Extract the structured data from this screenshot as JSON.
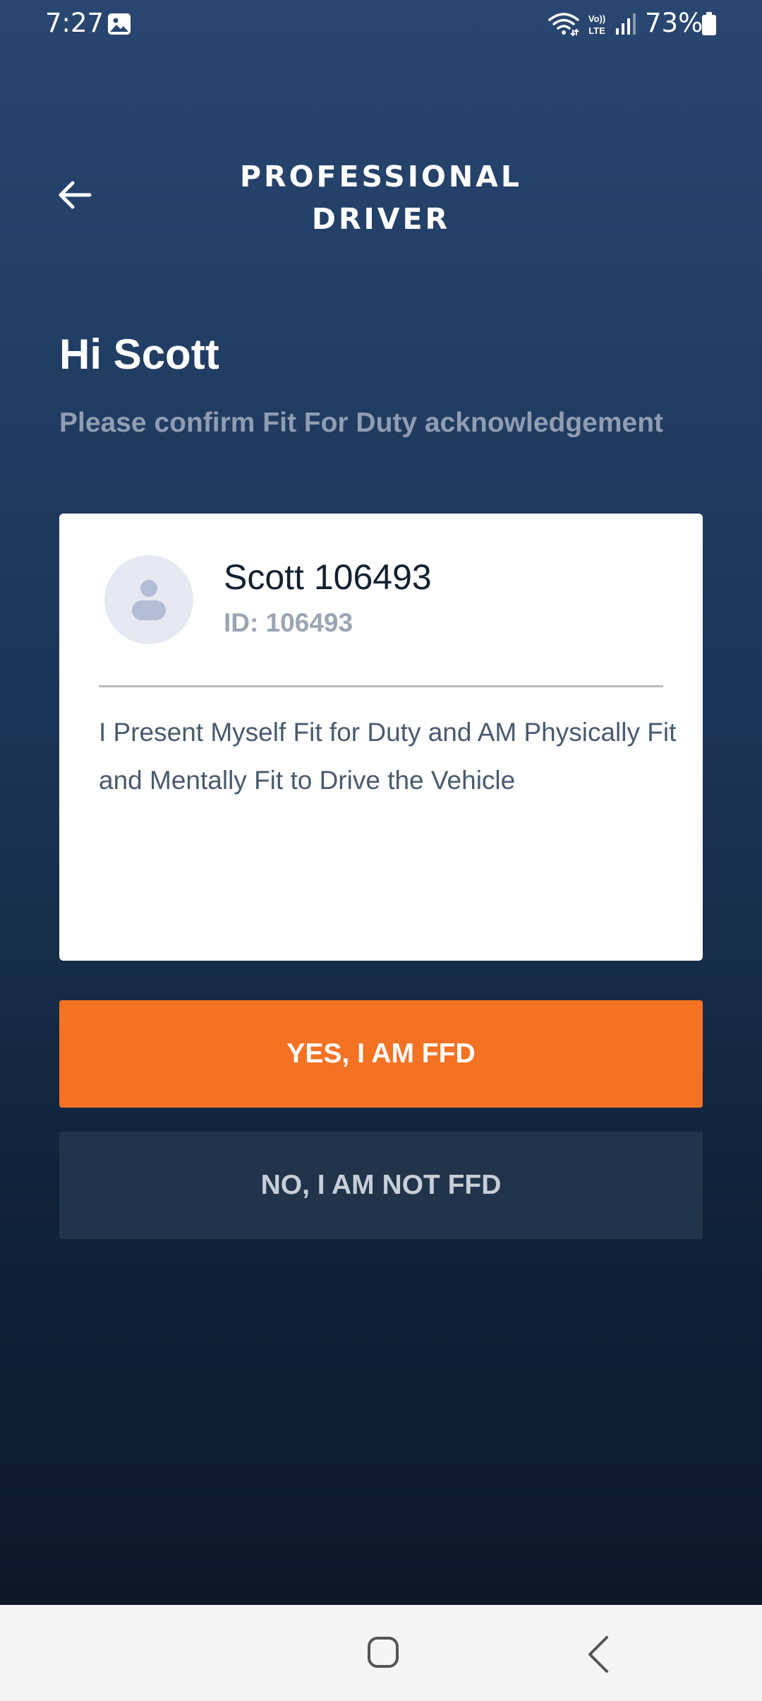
{
  "status_bar": {
    "time": "7:27",
    "battery": "73%",
    "icons": [
      "gallery-icon",
      "wifi-icon",
      "volte-icon",
      "signal-icon",
      "battery-icon"
    ]
  },
  "header": {
    "title_line1": "PROFESSIONAL",
    "title_line2": "DRIVER",
    "back_icon": "arrow-left-icon"
  },
  "greeting": {
    "title": "Hi Scott",
    "subtitle": "Please confirm Fit For Duty acknowledgement"
  },
  "card": {
    "avatar_icon": "user-avatar-icon",
    "driver_name": "Scott 106493",
    "driver_id": "ID: 106493",
    "declaration": "I Present Myself Fit for Duty and AM Physically Fit and Mentally Fit to Drive the Vehicle"
  },
  "actions": {
    "yes_label": "YES, I AM FFD",
    "no_label": "NO, I AM NOT FFD"
  },
  "nav_bar": {
    "icons": [
      "home-icon",
      "back-icon"
    ]
  },
  "colors": {
    "accent": "#f37223",
    "background_top": "#284670",
    "background_bottom": "#0b1828",
    "secondary_button": "#22344b"
  }
}
